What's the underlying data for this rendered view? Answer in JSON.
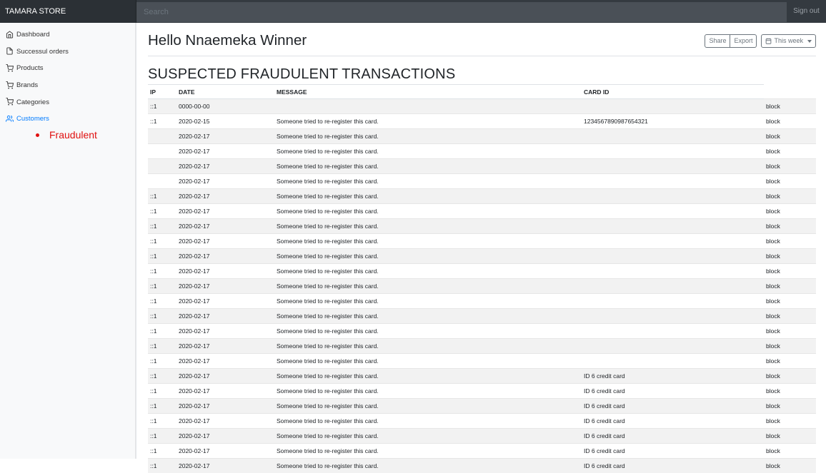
{
  "navbar": {
    "brand": "TAMARA STORE",
    "search_placeholder": "Search",
    "signout_label": "Sign out"
  },
  "sidebar": {
    "items": [
      {
        "label": "Dashboard",
        "icon": "home-icon"
      },
      {
        "label": "Successul orders",
        "icon": "file-icon"
      },
      {
        "label": "Products",
        "icon": "shopping-cart-icon"
      },
      {
        "label": "Brands",
        "icon": "shopping-cart-icon"
      },
      {
        "label": "Categories",
        "icon": "shopping-cart-icon"
      },
      {
        "label": "Customers",
        "icon": "users-icon",
        "active": true
      }
    ],
    "subitems": [
      "Fraudulent"
    ]
  },
  "header": {
    "greeting": "Hello Nnaemeka Winner",
    "share_label": "Share",
    "export_label": "Export",
    "period_label": "This week"
  },
  "section_title": "SUSPECTED FRAUDULENT TRANSACTIONS",
  "table": {
    "columns": [
      "IP",
      "DATE",
      "MESSAGE",
      "CARD ID",
      ""
    ],
    "rows": [
      [
        "::1",
        "0000-00-00",
        "",
        "",
        "block"
      ],
      [
        "::1",
        "2020-02-15",
        "Someone tried to re-register this card.",
        "1234567890987654321",
        "block"
      ],
      [
        "",
        "2020-02-17",
        "Someone tried to re-register this card.",
        "",
        "block"
      ],
      [
        "",
        "2020-02-17",
        "Someone tried to re-register this card.",
        "",
        "block"
      ],
      [
        "",
        "2020-02-17",
        "Someone tried to re-register this card.",
        "",
        "block"
      ],
      [
        "",
        "2020-02-17",
        "Someone tried to re-register this card.",
        "",
        "block"
      ],
      [
        "::1",
        "2020-02-17",
        "Someone tried to re-register this card.",
        "",
        "block"
      ],
      [
        "::1",
        "2020-02-17",
        "Someone tried to re-register this card.",
        "",
        "block"
      ],
      [
        "::1",
        "2020-02-17",
        "Someone tried to re-register this card.",
        "",
        "block"
      ],
      [
        "::1",
        "2020-02-17",
        "Someone tried to re-register this card.",
        "",
        "block"
      ],
      [
        "::1",
        "2020-02-17",
        "Someone tried to re-register this card.",
        "",
        "block"
      ],
      [
        "::1",
        "2020-02-17",
        "Someone tried to re-register this card.",
        "",
        "block"
      ],
      [
        "::1",
        "2020-02-17",
        "Someone tried to re-register this card.",
        "",
        "block"
      ],
      [
        "::1",
        "2020-02-17",
        "Someone tried to re-register this card.",
        "",
        "block"
      ],
      [
        "::1",
        "2020-02-17",
        "Someone tried to re-register this card.",
        "",
        "block"
      ],
      [
        "::1",
        "2020-02-17",
        "Someone tried to re-register this card.",
        "",
        "block"
      ],
      [
        "::1",
        "2020-02-17",
        "Someone tried to re-register this card.",
        "",
        "block"
      ],
      [
        "::1",
        "2020-02-17",
        "Someone tried to re-register this card.",
        "",
        "block"
      ],
      [
        "::1",
        "2020-02-17",
        "Someone tried to re-register this card.",
        "ID 6 credit card",
        "block"
      ],
      [
        "::1",
        "2020-02-17",
        "Someone tried to re-register this card.",
        "ID 6 credit card",
        "block"
      ],
      [
        "::1",
        "2020-02-17",
        "Someone tried to re-register this card.",
        "ID 6 credit card",
        "block"
      ],
      [
        "::1",
        "2020-02-17",
        "Someone tried to re-register this card.",
        "ID 6 credit card",
        "block"
      ],
      [
        "::1",
        "2020-02-17",
        "Someone tried to re-register this card.",
        "ID 6 credit card",
        "block"
      ],
      [
        "::1",
        "2020-02-17",
        "Someone tried to re-register this card.",
        "ID 6 credit card",
        "block"
      ],
      [
        "::1",
        "2020-02-17",
        "Someone tried to re-register this card.",
        "ID 6 credit card",
        "block"
      ]
    ]
  },
  "colors": {
    "navbar": "#343a40",
    "active": "#007bff",
    "fraud_link": "#e0100f"
  }
}
